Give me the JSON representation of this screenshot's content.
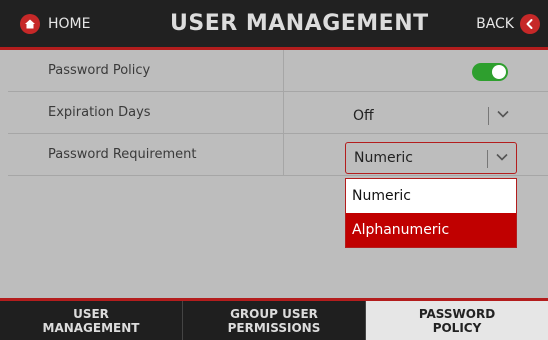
{
  "header": {
    "home_label": "HOME",
    "title": "USER MANAGEMENT",
    "back_label": "BACK"
  },
  "settings": {
    "password_policy": {
      "label": "Password Policy",
      "enabled": true
    },
    "expiration_days": {
      "label": "Expiration Days",
      "value": "Off"
    },
    "password_requirement": {
      "label": "Password Requirement",
      "value": "Numeric"
    }
  },
  "dropdown": {
    "options": [
      "Numeric",
      "Alphanumeric"
    ],
    "highlighted": "Alphanumeric"
  },
  "tabs": [
    {
      "line1": "USER",
      "line2": "MANAGEMENT",
      "active": false
    },
    {
      "line1": "GROUP USER",
      "line2": "PERMISSIONS",
      "active": false
    },
    {
      "line1": "PASSWORD",
      "line2": "POLICY",
      "active": true
    }
  ],
  "colors": {
    "accent": "#b31d1d",
    "toggle_on": "#2e9f2e",
    "highlight": "#c00000"
  }
}
